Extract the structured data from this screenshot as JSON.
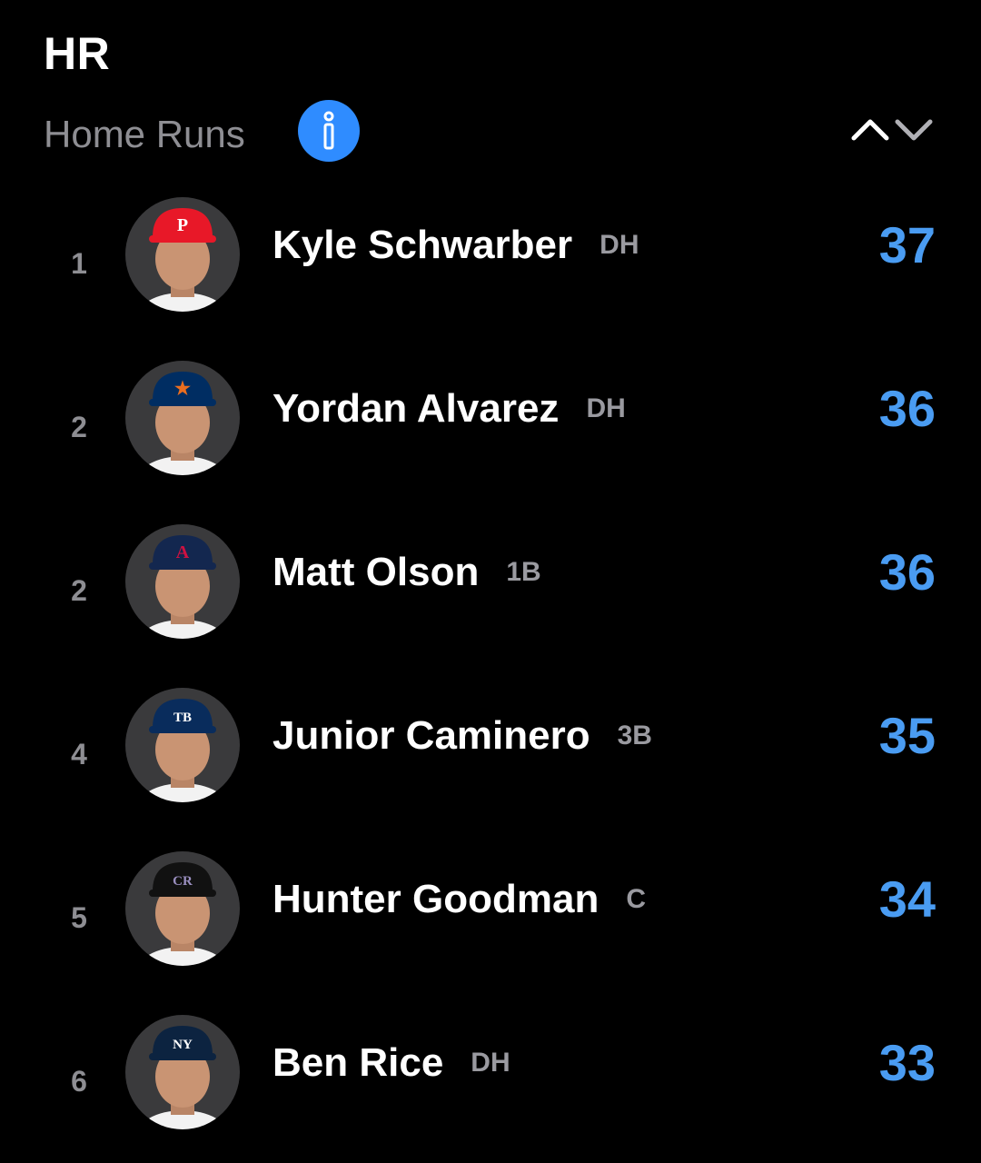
{
  "header": {
    "stat_abbr": "HR",
    "stat_full": "Home Runs",
    "info_icon": "info-icon",
    "sort_up_icon": "chevron-up-icon",
    "sort_down_icon": "chevron-down-icon"
  },
  "colors": {
    "background": "#000000",
    "accent": "#4a9cf2",
    "info_button": "#2f8cff",
    "muted_text": "#8e8e93"
  },
  "leaders": [
    {
      "rank": "1",
      "name": "Kyle Schwarber",
      "position": "DH",
      "value": "37",
      "team_cap_color": "#e81828",
      "team_logo": "P",
      "logo_color": "#ffffff"
    },
    {
      "rank": "2",
      "name": "Yordan Alvarez",
      "position": "DH",
      "value": "36",
      "team_cap_color": "#002d62",
      "team_logo": "★",
      "logo_color": "#eb6e1f"
    },
    {
      "rank": "2",
      "name": "Matt Olson",
      "position": "1B",
      "value": "36",
      "team_cap_color": "#13274f",
      "team_logo": "A",
      "logo_color": "#ce1141"
    },
    {
      "rank": "4",
      "name": "Junior Caminero",
      "position": "3B",
      "value": "35",
      "team_cap_color": "#092c5c",
      "team_logo": "TB",
      "logo_color": "#ffffff"
    },
    {
      "rank": "5",
      "name": "Hunter Goodman",
      "position": "C",
      "value": "34",
      "team_cap_color": "#111111",
      "team_logo": "CR",
      "logo_color": "#9a8fc0"
    },
    {
      "rank": "6",
      "name": "Ben Rice",
      "position": "DH",
      "value": "33",
      "team_cap_color": "#0c2340",
      "team_logo": "NY",
      "logo_color": "#ffffff"
    }
  ]
}
